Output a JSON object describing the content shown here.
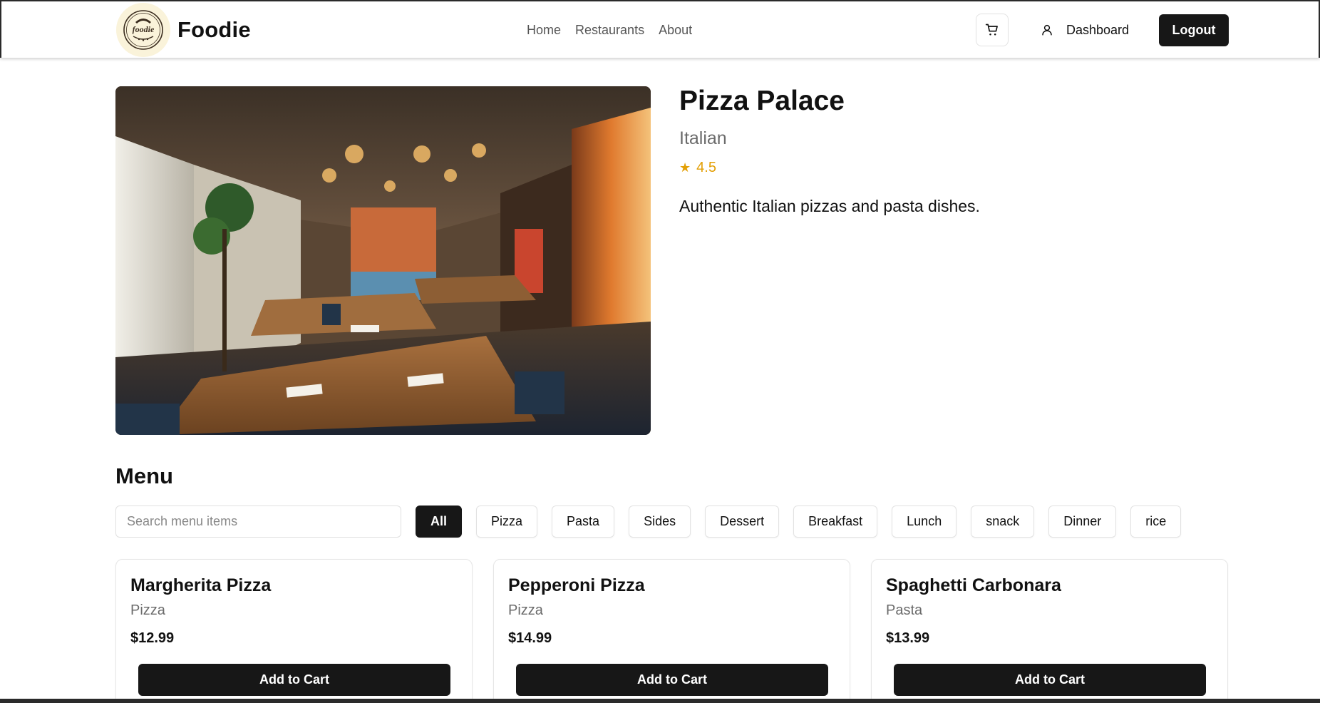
{
  "header": {
    "brand": "Foodie",
    "logo_text": "foodie",
    "nav": [
      {
        "label": "Home"
      },
      {
        "label": "Restaurants"
      },
      {
        "label": "About"
      }
    ],
    "cart_icon": "cart-icon",
    "user_icon": "user-icon",
    "dashboard_label": "Dashboard",
    "logout_label": "Logout"
  },
  "restaurant": {
    "name": "Pizza Palace",
    "cuisine": "Italian",
    "rating": "4.5",
    "star_icon": "star-icon",
    "description": "Authentic Italian pizzas and pasta dishes.",
    "rating_color": "#e3a007"
  },
  "menu": {
    "title": "Menu",
    "search_placeholder": "Search menu items",
    "filters": [
      {
        "label": "All",
        "active": true
      },
      {
        "label": "Pizza"
      },
      {
        "label": "Pasta"
      },
      {
        "label": "Sides"
      },
      {
        "label": "Dessert"
      },
      {
        "label": "Breakfast"
      },
      {
        "label": "Lunch"
      },
      {
        "label": "snack"
      },
      {
        "label": "Dinner"
      },
      {
        "label": "rice"
      }
    ],
    "items": [
      {
        "name": "Margherita Pizza",
        "category": "Pizza",
        "price": "$12.99",
        "button": "Add to Cart"
      },
      {
        "name": "Pepperoni Pizza",
        "category": "Pizza",
        "price": "$14.99",
        "button": "Add to Cart"
      },
      {
        "name": "Spaghetti Carbonara",
        "category": "Pasta",
        "price": "$13.99",
        "button": "Add to Cart"
      }
    ]
  },
  "colors": {
    "primary_button": "#171717",
    "muted_text": "#6b6b6b",
    "logo_bg": "#faf3da"
  }
}
